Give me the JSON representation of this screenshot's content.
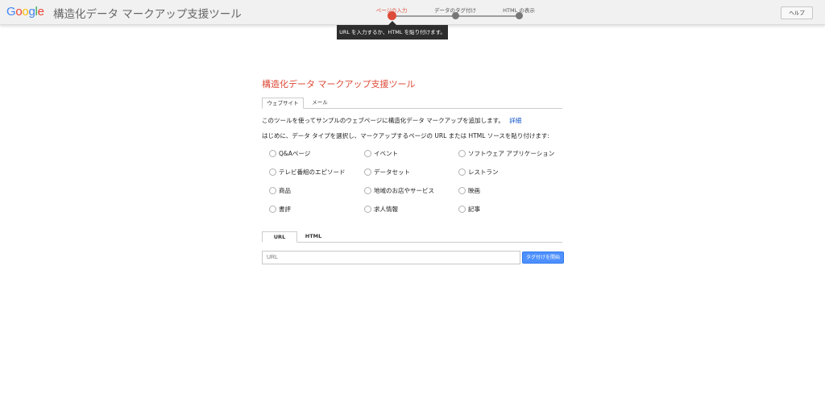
{
  "header": {
    "logo": [
      {
        "ch": "G",
        "color": "#4285F4"
      },
      {
        "ch": "o",
        "color": "#EA4335"
      },
      {
        "ch": "o",
        "color": "#FBBC05"
      },
      {
        "ch": "g",
        "color": "#4285F4"
      },
      {
        "ch": "l",
        "color": "#34A853"
      },
      {
        "ch": "e",
        "color": "#EA4335"
      }
    ],
    "app_title": "構造化データ マークアップ支援ツール",
    "steps": [
      "ページの入力",
      "データのタグ付け",
      "HTML の表示"
    ],
    "active_step": 0,
    "help_label": "ヘルプ",
    "tooltip": "URL を入力するか、HTML を貼り付けます。"
  },
  "main": {
    "title": "構造化データ マークアップ支援ツール",
    "source_tabs": [
      "ウェブサイト",
      "メール"
    ],
    "description": "このツールを使ってサンプルのウェブページに構造化データ マークアップを追加します。",
    "details_link": "詳細",
    "instruction": "はじめに、データ タイプを選択し、マークアップするページの URL または HTML ソースを貼り付けます:",
    "data_types": [
      [
        "Q&Aページ",
        "イベント",
        "ソフトウェア アプリケーション"
      ],
      [
        "テレビ番組のエピソード",
        "データセット",
        "レストラン"
      ],
      [
        "商品",
        "地域のお店やサービス",
        "映画"
      ],
      [
        "書評",
        "求人情報",
        "記事"
      ]
    ],
    "input_tabs": [
      "URL",
      "HTML"
    ],
    "url_placeholder": "URL",
    "start_button": "タグ付けを開始"
  }
}
